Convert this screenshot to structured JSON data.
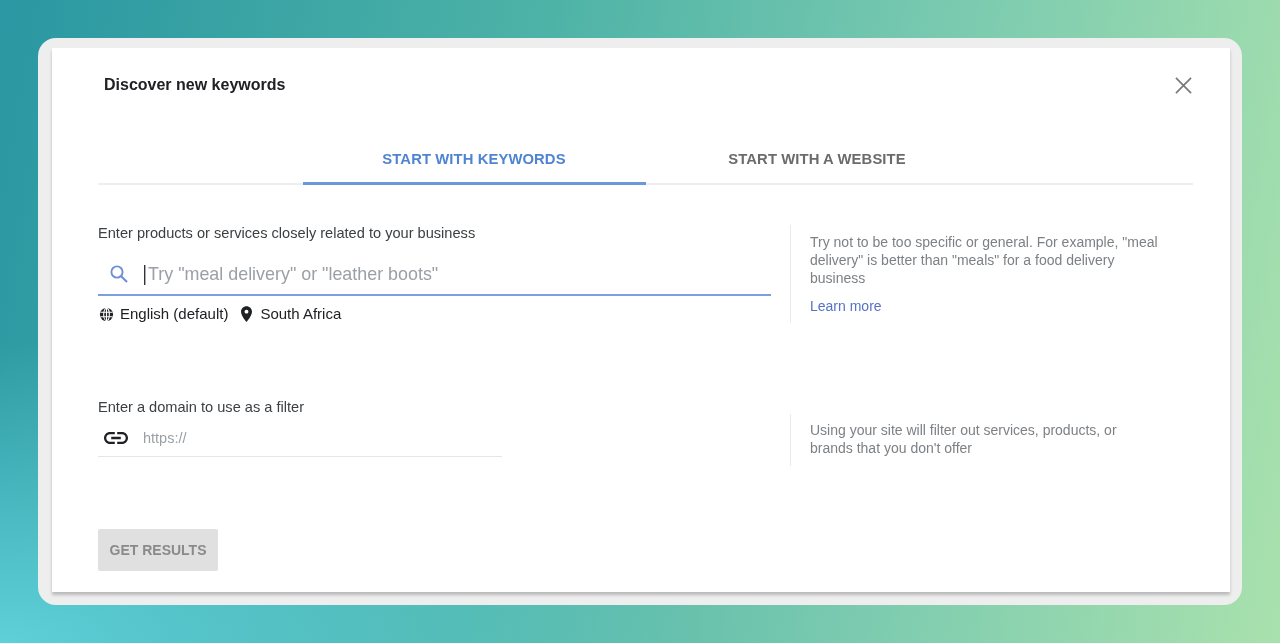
{
  "dialog": {
    "title": "Discover new keywords"
  },
  "tabs": [
    {
      "label": "START WITH KEYWORDS",
      "selected": true
    },
    {
      "label": "START WITH A WEBSITE",
      "selected": false
    }
  ],
  "sections": [
    {
      "kind": "keywords",
      "label": "Enter products or services closely related to your business",
      "placeholder": "Try \"meal delivery\" or \"leather boots\"",
      "focused": true,
      "language": "English (default)",
      "location": "South Africa",
      "hint": "Try not to be too specific or general. For example, \"meal delivery\" is better than \"meals\" for a food delivery business",
      "link": "Learn more"
    },
    {
      "kind": "domain",
      "label": "Enter a domain to use as a filter",
      "placeholder": "https://",
      "focused": false,
      "hint": "Using your site will filter out services, products, or brands that you don't offer"
    }
  ],
  "submit": {
    "label": "GET RESULTS",
    "disabled": true
  }
}
